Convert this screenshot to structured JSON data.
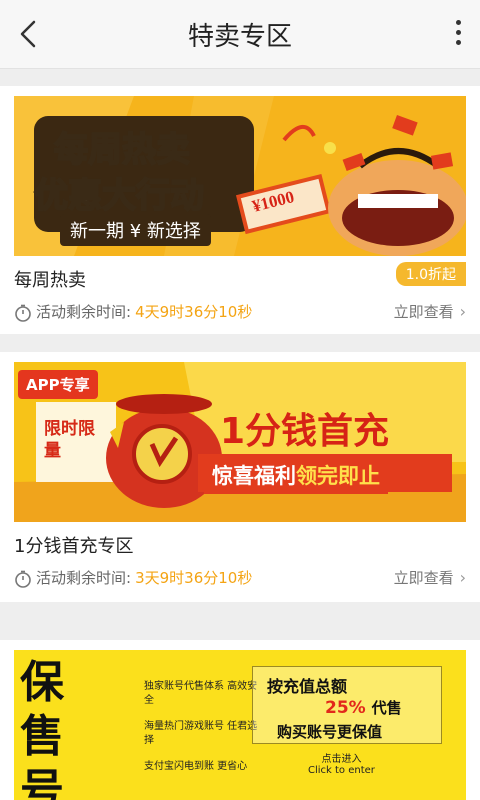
{
  "header": {
    "title": "特卖专区",
    "back_icon": "chevron-left-icon",
    "more_icon": "more-vertical-icon"
  },
  "cards": [
    {
      "banner": {
        "line1": "每周热卖",
        "line2": "优惠大行动",
        "line3": "新一期 ¥ 新选择",
        "price_tag": "¥1000",
        "colors": {
          "background": "#f6b41c",
          "text": "#ffffff",
          "outline": "#3a2a16"
        }
      },
      "title": "每周热卖",
      "badge": "1.0折起",
      "time_label": "活动剩余时间:",
      "countdown": "4天9时36分10秒",
      "view_label": "立即查看"
    },
    {
      "banner": {
        "app_tag": "APP专享",
        "limited": "限时限量",
        "main": "1分钱首充",
        "sub_a": "惊喜福利",
        "sub_b": "领完即止",
        "colors": {
          "background": "#f7c318",
          "accent": "#d62316"
        }
      },
      "title": "1分钱首充专区",
      "time_label": "活动剩余时间:",
      "countdown": "3天9时36分10秒",
      "view_label": "立即查看"
    },
    {
      "banner": {
        "big": "保售号",
        "points": [
          "独家账号代售体系 高效安全",
          "海量热门游戏账号 任君选择",
          "支付宝闪电到账 更省心"
        ],
        "box_l1": "按充值总额",
        "box_l2": "25%",
        "box_l2_tail": "代售",
        "box_l3": "购买账号更保值",
        "click_cn": "点击进入",
        "click_en": "Click to enter",
        "colors": {
          "background": "#fbe01c"
        }
      }
    }
  ],
  "countdown_color": "#f4a414"
}
